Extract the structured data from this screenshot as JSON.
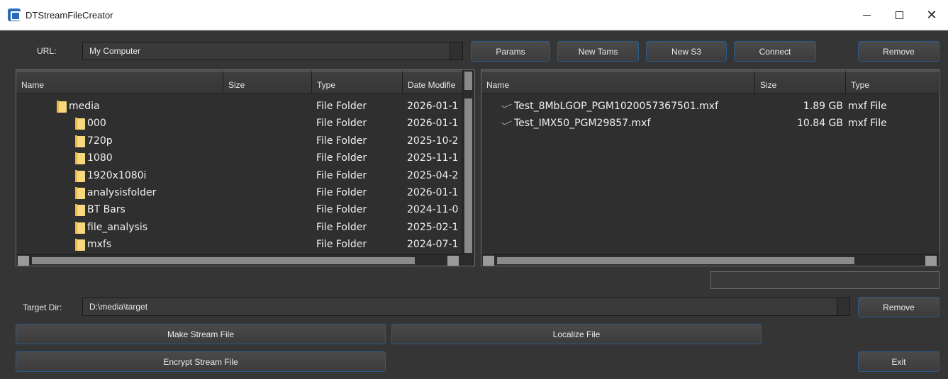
{
  "window": {
    "title": "DTStreamFileCreator",
    "close_glyph": "✕"
  },
  "url_bar": {
    "label": "URL:",
    "value": "My Computer",
    "buttons": {
      "params": "Params",
      "new_tams": "New Tams",
      "new_s3": "New S3",
      "connect": "Connect",
      "remove": "Remove"
    }
  },
  "left_panel": {
    "headers": [
      "Name",
      "Size",
      "Type",
      "Date Modifie"
    ],
    "rows": [
      {
        "name": "media",
        "type": "File Folder",
        "date": "2026-01-1",
        "icon": "folder-icon"
      },
      {
        "name": "000",
        "type": "File Folder",
        "date": "2026-01-1",
        "icon": "folder-icon"
      },
      {
        "name": "720p",
        "type": "File Folder",
        "date": "2025-10-2",
        "icon": "folder-icon"
      },
      {
        "name": "1080",
        "type": "File Folder",
        "date": "2025-11-1",
        "icon": "folder-icon"
      },
      {
        "name": "1920x1080i",
        "type": "File Folder",
        "date": "2025-04-2",
        "icon": "folder-icon"
      },
      {
        "name": "analysisfolder",
        "type": "File Folder",
        "date": "2026-01-1",
        "icon": "folder-icon"
      },
      {
        "name": "BT Bars",
        "type": "File Folder",
        "date": "2024-11-0",
        "icon": "folder-icon"
      },
      {
        "name": "file_analysis",
        "type": "File Folder",
        "date": "2025-02-1",
        "icon": "folder-icon"
      },
      {
        "name": "mxfs",
        "type": "File Folder",
        "date": "2024-07-1",
        "icon": "folder-icon"
      }
    ]
  },
  "right_panel": {
    "headers": [
      "Name",
      "Size",
      "Type"
    ],
    "rows": [
      {
        "name": "Test_8MbLGOP_PGM1020057367501.mxf",
        "size": "1.89 GB",
        "type": "mxf File",
        "icon": "mxf-file-icon"
      },
      {
        "name": "Test_IMX50_PGM29857.mxf",
        "size": "10.84 GB",
        "type": "mxf File",
        "icon": "mxf-file-icon"
      }
    ]
  },
  "target_dir": {
    "label": "Target Dir:",
    "value": "D:\\media\\target",
    "remove": "Remove"
  },
  "actions": {
    "make_stream_file": "Make Stream File",
    "localize_file": "Localize File",
    "encrypt_stream_file": "Encrypt Stream File",
    "exit": "Exit"
  },
  "colors": {
    "background": "#353535",
    "panel": "#2f2f2f",
    "button_border": "#2a5a8a",
    "folder": "#f7d87c"
  }
}
